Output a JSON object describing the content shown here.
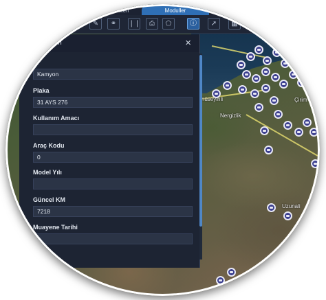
{
  "tabs": [
    {
      "label": "...lleri"
    },
    {
      "label": "Moduller"
    }
  ],
  "toolbar": {
    "icons": [
      "edit-icon",
      "link-icon",
      "columns-icon",
      "print-icon",
      "shape-icon",
      "info-icon",
      "pointer-icon",
      "table-icon"
    ],
    "active": "info-icon"
  },
  "panel": {
    "title": "...leri",
    "close": "×",
    "fields": [
      {
        "label": "...",
        "value": "Kamyon"
      },
      {
        "label": "Plaka",
        "value": "31 AYS 276"
      },
      {
        "label": "Kullanım Amacı",
        "value": ""
      },
      {
        "label": "Araç Kodu",
        "value": "0"
      },
      {
        "label": "Model Yılı",
        "value": ""
      },
      {
        "label": "Güncel KM",
        "value": "7218"
      },
      {
        "label": "Muayene Tarihi",
        "value": ""
      }
    ]
  },
  "map": {
    "towns": [
      "Karahüseyinli",
      "Nergizlik",
      "Çirim",
      "Uzunali"
    ]
  }
}
